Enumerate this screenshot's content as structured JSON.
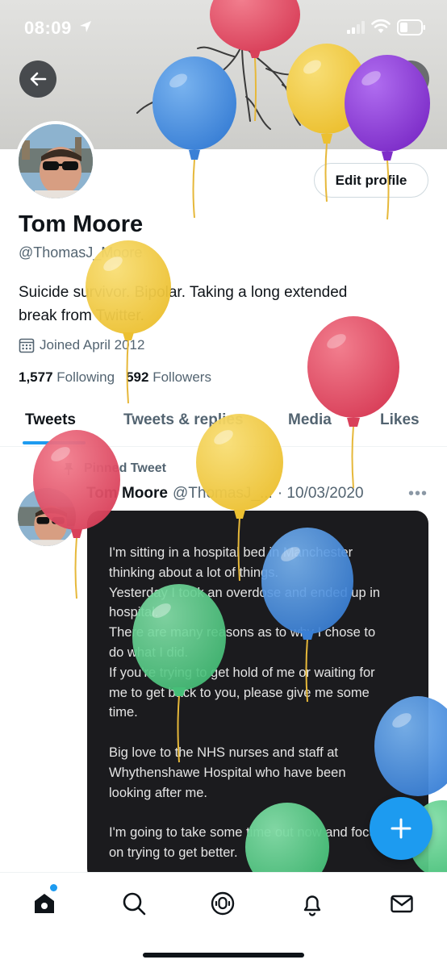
{
  "status_bar": {
    "time": "08:09"
  },
  "profile": {
    "name": "Tom Moore",
    "handle": "@ThomasJ_Moore",
    "edit_label": "Edit profile",
    "bio_line1": "Suicide survivor. Bipolar. Taking a long extended",
    "bio_line2": "break from Twitter.",
    "joined": "Joined April 2012",
    "following_count": "1,577",
    "following_label": "Following",
    "followers_count": "592",
    "followers_label": "Followers"
  },
  "tabs": [
    {
      "label": "Tweets",
      "active": true
    },
    {
      "label": "Tweets & replies",
      "active": false
    },
    {
      "label": "Media",
      "active": false
    },
    {
      "label": "Likes",
      "active": false
    }
  ],
  "pinned_tweet": {
    "pinned_label": "Pinned Tweet",
    "author_name": "Tom Moore",
    "author_handle": "@ThomasJ_...",
    "date": "· 10/03/2020",
    "image_text": {
      "p1": "I'm sitting in a hospital bed in Manchester\nthinking about a lot of things.\nYesterday I took an overdose and ended up in\nhospital.\nThere are many reasons as to why I chose to\ndo what I did.\nIf you're trying to get hold of me or waiting for\nme to get back to you, please give me some\ntime.",
      "p2": "Big love to the NHS nurses and staff at\nWhythenshawe Hospital who have been\nlooking after me.",
      "p3": "I'm going to take some time out now and focus\non trying to get better."
    }
  },
  "icons": {
    "back": "arrow-left-icon",
    "search": "search-icon",
    "compose": "plus-icon",
    "nav": [
      "home-icon",
      "explore-icon",
      "spaces-icon",
      "notifications-icon",
      "messages-icon"
    ]
  },
  "colors": {
    "accent": "#1d9bf0",
    "balloon_red": "#e5566b",
    "balloon_yellow": "#f2cf48",
    "balloon_blue": "#4a90e2",
    "balloon_purple": "#8e3fd6",
    "balloon_green": "#5ccf8c"
  }
}
